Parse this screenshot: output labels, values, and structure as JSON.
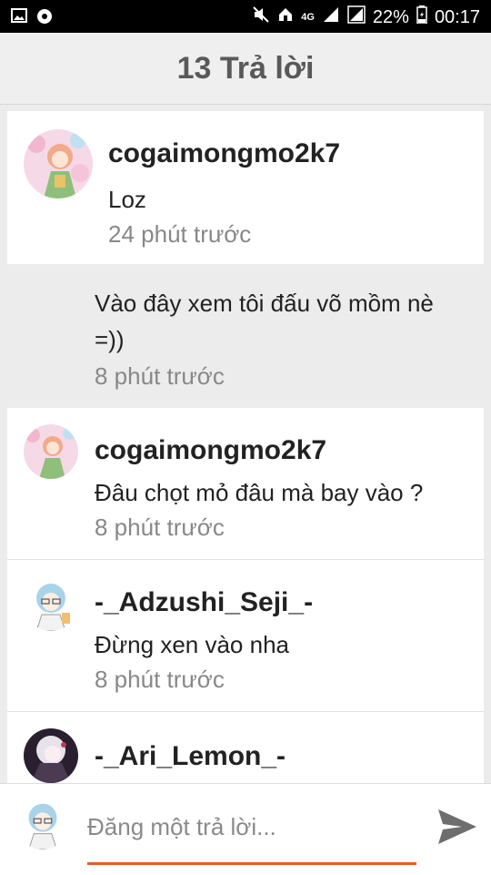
{
  "status_bar": {
    "network": "4G",
    "battery": "22%",
    "time": "00:17"
  },
  "header": {
    "title": "13 Trả lời"
  },
  "replies": [
    {
      "username": "cogaimongmo2k7",
      "message": "Loz",
      "time": "24 phút trước"
    },
    {
      "message_line1": "Vào đây xem tôi đấu võ mồm nè",
      "message_line2": "=))",
      "time": "8 phút trước"
    },
    {
      "username": "cogaimongmo2k7",
      "message": "Đâu chọt mỏ đâu mà bay vào ?",
      "time": "8 phút trước"
    },
    {
      "username": "-_Adzushi_Seji_-",
      "message": "Đừng xen vào nha",
      "time": "8 phút trước"
    },
    {
      "username": "-_Ari_Lemon_-"
    }
  ],
  "composer": {
    "placeholder": "Đăng một trả lời..."
  },
  "colors": {
    "accent": "#ee5a24",
    "header_bg": "#efefef",
    "muted_text": "#888888"
  }
}
